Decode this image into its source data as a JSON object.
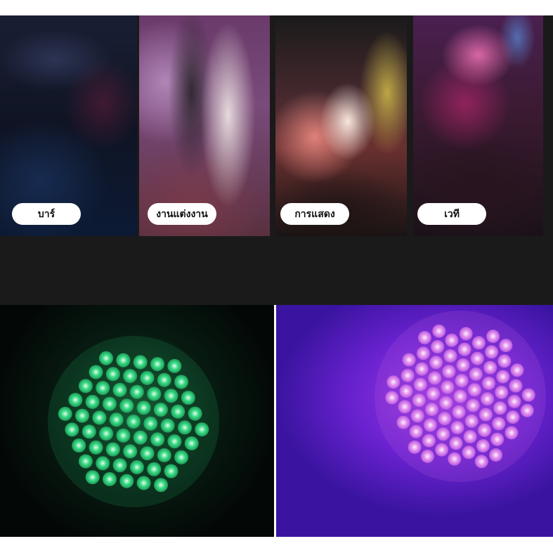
{
  "panels": [
    {
      "label": "บาร์"
    },
    {
      "label": "งานแต่งงาน"
    },
    {
      "label": "การแสดง"
    },
    {
      "label": "เวที"
    }
  ],
  "lights": {
    "green": {
      "color": "#3fe08a",
      "glow": "#1fa860"
    },
    "purple": {
      "color": "#e79af0",
      "glow": "#c060e0"
    }
  }
}
